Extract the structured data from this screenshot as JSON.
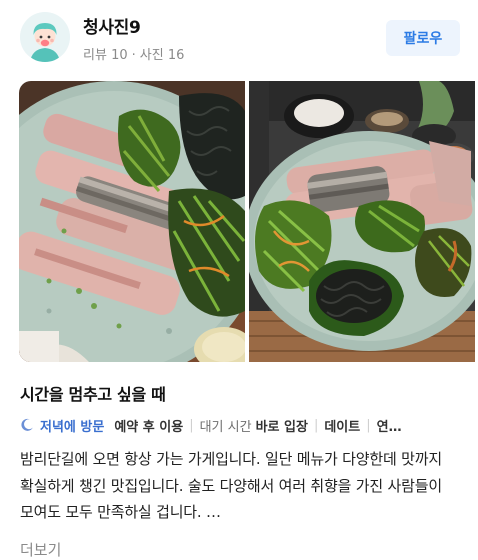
{
  "profile": {
    "name": "청사진9",
    "review_label": "리뷰",
    "review_count": "10",
    "separator": "·",
    "photo_label": "사진",
    "photo_count": "16",
    "follow_label": "팔로우",
    "avatar_icon": "user-avatar-icon"
  },
  "photos": [
    {
      "alt": "mackerel sashimi platter with seaweed and greens",
      "icon": "food-photo"
    },
    {
      "alt": "table spread with sashimi plate and side dishes",
      "icon": "food-photo"
    }
  ],
  "review": {
    "title": "시간을 멈추고 싶을 때",
    "tags": {
      "visit_time": "저녁에 방문",
      "reservation": "예약 후 이용",
      "wait_label": "대기 시간",
      "wait_value": "바로 입장",
      "purpose": "데이트",
      "truncated": "연…"
    },
    "text": "밤리단길에 오면 항상 가는 가게입니다. 일단 메뉴가 다양한데 맛까지 확실하게 챙긴 맛집입니다. 술도 다양해서 여러 취향을 가진 사람들이 모여도 모두 만족하실 겁니다. …",
    "more_label": "더보기"
  },
  "colors": {
    "follow_bg": "#edf4fd",
    "follow_text": "#2c7be5",
    "visit_tag": "#3a6fcf",
    "meta_text": "#8a8a8a"
  }
}
